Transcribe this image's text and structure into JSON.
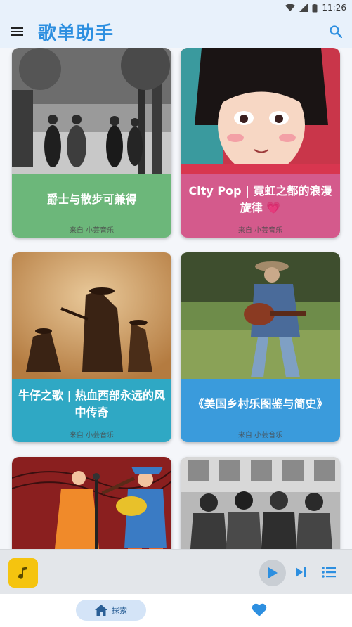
{
  "status": {
    "time": "11:26"
  },
  "app": {
    "title": "歌单助手"
  },
  "icons": {
    "menu": "hamburger-menu-icon",
    "search": "search-icon",
    "play": "play-icon",
    "next": "skip-next-icon",
    "queue": "playlist-icon",
    "home": "home-icon",
    "heart": "heart-icon",
    "music": "music-note-icon"
  },
  "colors": {
    "accent": "#2d8fe0",
    "card_green": "#6cb77a",
    "card_pink": "#d45a8c",
    "card_cyan": "#2fa8c4",
    "card_blue": "#3a9bdc",
    "player_thumb": "#f5c40f"
  },
  "playlists": [
    {
      "title": "爵士与散步可兼得",
      "source": "来自 小芸音乐"
    },
    {
      "title": "City Pop | 霓虹之都的浪漫旋律 💗",
      "source": "来自 小芸音乐"
    },
    {
      "title": "牛仔之歌 | 热血西部永远的风中传奇",
      "source": "来自 小芸音乐"
    },
    {
      "title": "《美国乡村乐图鉴与简史》",
      "source": "来自 小芸音乐"
    },
    {
      "title": "",
      "source": ""
    },
    {
      "title": "",
      "source": ""
    }
  ],
  "bottom_nav": {
    "explore_label": "探索"
  }
}
